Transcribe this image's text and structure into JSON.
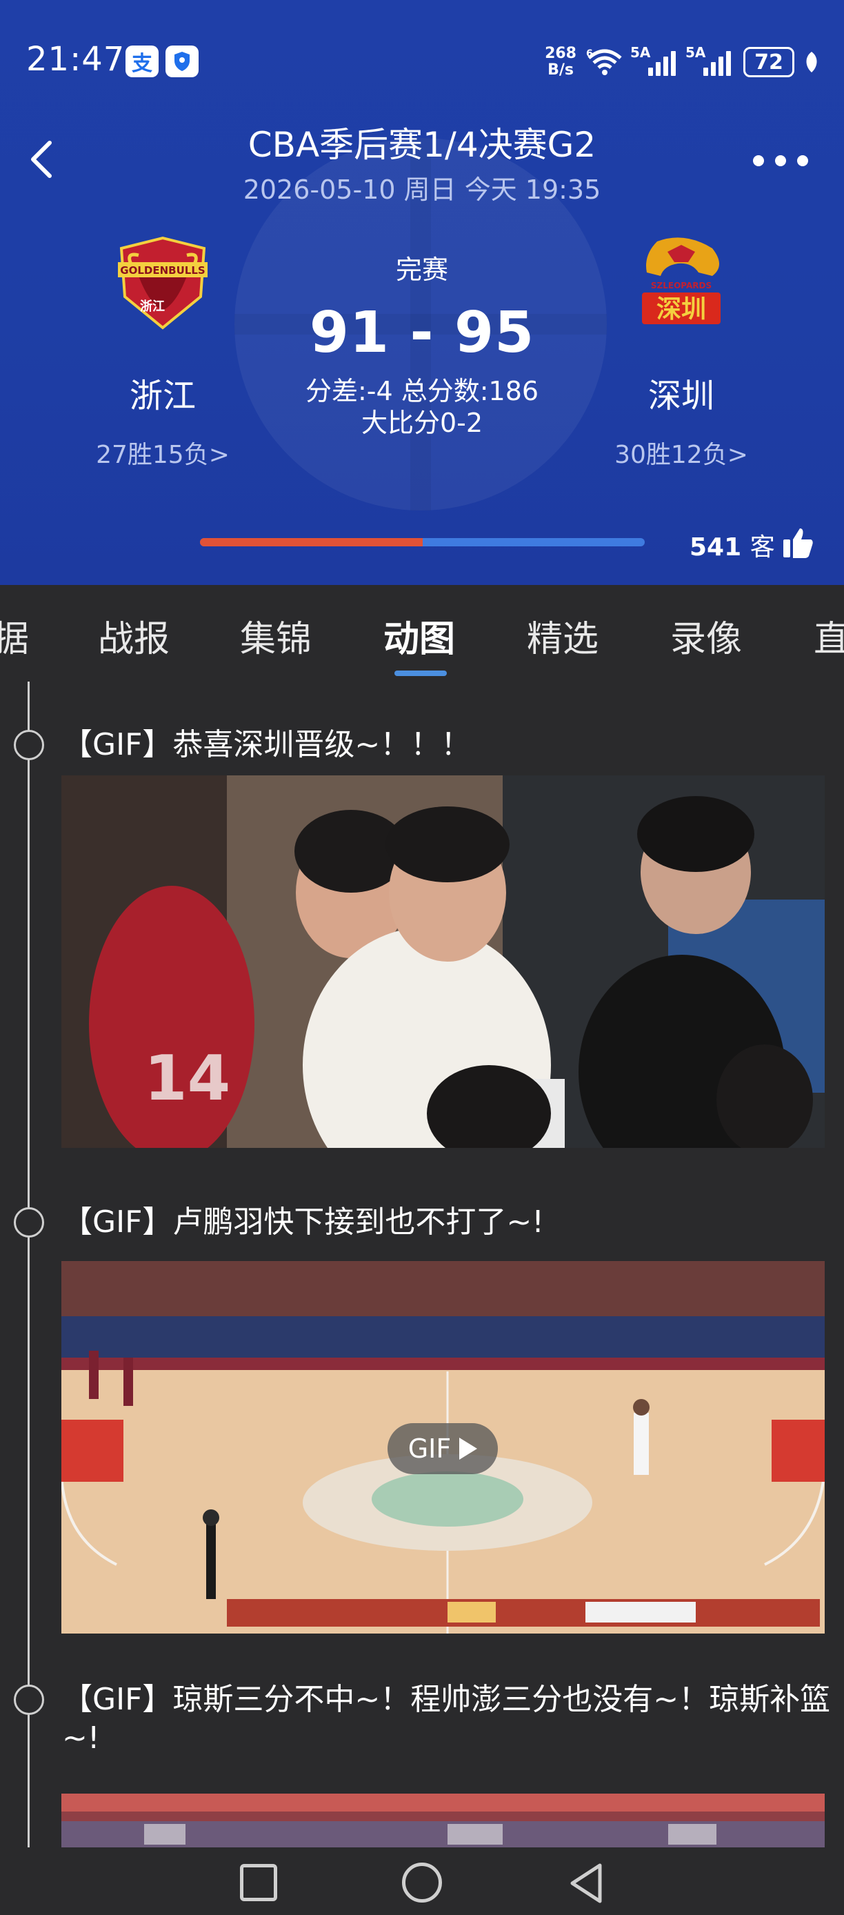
{
  "status_bar": {
    "time": "21:47",
    "net_speed_value": "268",
    "net_speed_unit": "B/s",
    "wifi_label": "6",
    "sim1_label": "5A",
    "sim2_label": "5A",
    "battery": "72",
    "app_icons": [
      "alipay-icon",
      "shield-app-icon"
    ]
  },
  "header": {
    "title": "CBA季后赛1/4决赛G2",
    "subtitle": "2026-05-10 周日 今天 19:35",
    "home_team": {
      "name": "浙江",
      "record": "27胜15负>",
      "logo_text": "GOLDENBULLS",
      "logo_sub": "浙江"
    },
    "away_team": {
      "name": "深圳",
      "record": "30胜12负>",
      "logo_text": "SZLEOPARDS",
      "logo_sub": "深圳"
    },
    "status": "完赛",
    "score": "91 - 95",
    "score_info_line1": "分差:-4 总分数:186",
    "score_info_line2": "大比分0-2",
    "support": {
      "home_fraction": 0.5,
      "away_count": "541",
      "away_label": "客"
    }
  },
  "tabs": [
    {
      "label": "据"
    },
    {
      "label": "战报"
    },
    {
      "label": "集锦"
    },
    {
      "label": "动图",
      "active": true
    },
    {
      "label": "精选"
    },
    {
      "label": "录像"
    },
    {
      "label": "直"
    }
  ],
  "feed": [
    {
      "title": "【GIF】恭喜深圳晋级~！！！",
      "show_gif_badge": false
    },
    {
      "title": "【GIF】卢鹏羽快下接到也不打了~!",
      "show_gif_badge": true
    },
    {
      "title": "【GIF】琼斯三分不中~！程帅澎三分也没有~！琼斯补篮~!",
      "show_gif_badge": false
    }
  ],
  "gif_badge_label": "GIF",
  "colors": {
    "header_blue": "#1f3fa8",
    "home_red": "#e05237",
    "away_blue": "#3f7be0",
    "tab_accent": "#4b8fe0"
  }
}
